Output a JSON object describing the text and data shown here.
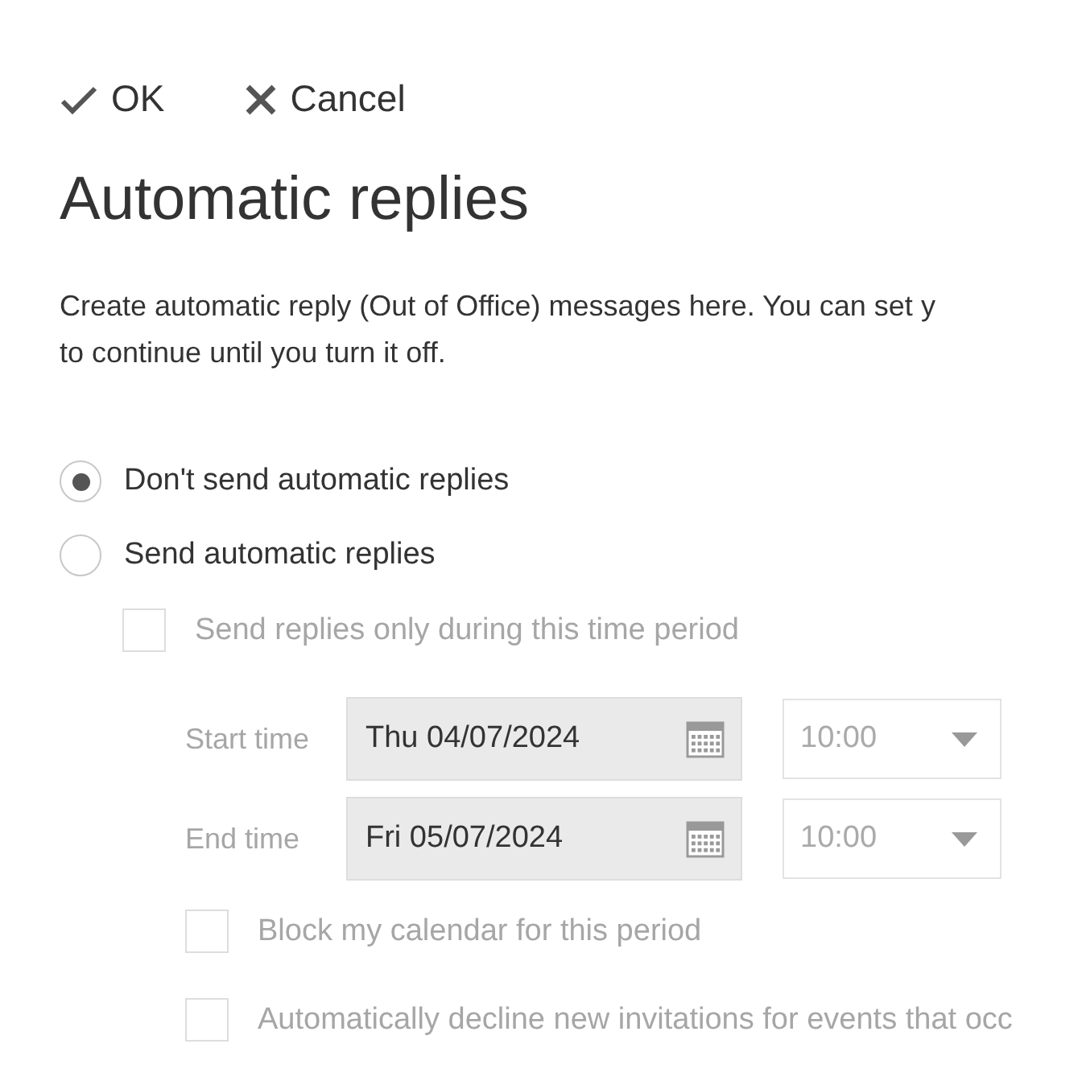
{
  "toolbar": [
    {
      "kind": "ok",
      "label": "OK"
    },
    {
      "kind": "cancel",
      "label": "Cancel"
    }
  ],
  "title": "Automatic replies",
  "description": [
    "Create automatic reply (Out of Office) messages here. You can set y",
    "to continue until you turn it off."
  ],
  "options": [
    {
      "label": "Don't send automatic replies",
      "selected": true
    },
    {
      "label": "Send automatic replies",
      "selected": false
    }
  ],
  "time_period": {
    "label": "Send replies only during this time period",
    "checked": false,
    "disabled": true
  },
  "times": [
    {
      "label": "Start time",
      "date": "Thu 04/07/2024",
      "time": "10:00",
      "disabled": true
    },
    {
      "label": "End time",
      "date": "Fri 05/07/2024",
      "time": "10:00",
      "disabled": true
    }
  ],
  "extras": [
    {
      "label": "Block my calendar for this period",
      "checked": false,
      "disabled": true
    },
    {
      "label": "Automatically decline new invitations for events that occ",
      "checked": false,
      "disabled": true
    }
  ]
}
